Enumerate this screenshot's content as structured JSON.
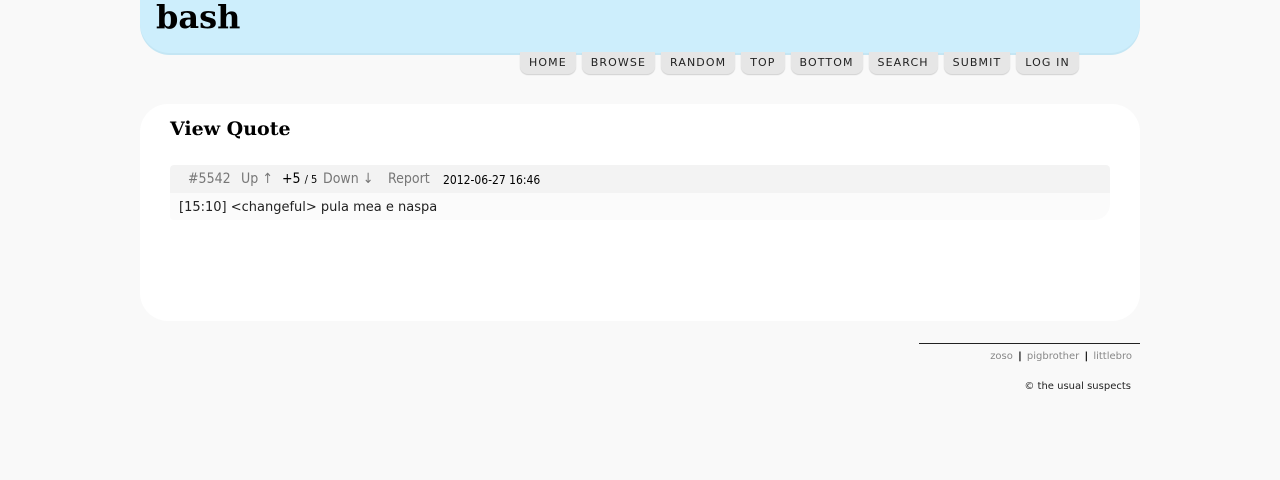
{
  "site": {
    "logo": "bash"
  },
  "nav": {
    "items": [
      "HOME",
      "BROWSE",
      "RANDOM",
      "TOP",
      "BOTTOM",
      "SEARCH",
      "SUBMIT",
      "LOG IN"
    ]
  },
  "panel": {
    "title": "View Quote",
    "quote": {
      "id": "#5542",
      "up_label": "Up ↑",
      "score": "+5",
      "votes": "/ 5",
      "down_label": "Down ↓",
      "report_label": "Report",
      "date": "2012-06-27 16:46",
      "text": "[15:10] <changeful> pula mea e naspa"
    }
  },
  "footer": {
    "links": [
      "zoso",
      "pigbrother",
      "littlebro"
    ],
    "separator": "|",
    "copyright": "© the usual suspects"
  }
}
